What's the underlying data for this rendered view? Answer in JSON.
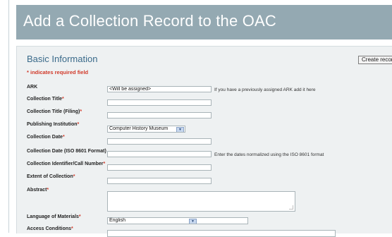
{
  "header": {
    "title": "Add a Collection Record to the OAC"
  },
  "form": {
    "section_title": "Basic Information",
    "required_note": "* indicates required field",
    "create_button_label": "Create record",
    "rows": {
      "ark": {
        "label": "ARK",
        "value": "<Will be assigned>",
        "hint": "If you have a previously assigned ARK add it here"
      },
      "collection_title": {
        "label": "Collection Title",
        "value": ""
      },
      "collection_title_filing": {
        "label": "Collection Title (Filing)",
        "value": ""
      },
      "publishing_institution": {
        "label": "Publishing Institution",
        "selected": "Computer History Museum"
      },
      "collection_date": {
        "label": "Collection Date",
        "value": ""
      },
      "collection_date_iso": {
        "label": "Collection Date (ISO 8601 Format)",
        "value": "",
        "hint": "Enter the dates normalized using the ISO 8601 format"
      },
      "collection_identifier": {
        "label": "Collection Identifier/Call Number",
        "value": ""
      },
      "extent": {
        "label": "Extent of Collection",
        "value": ""
      },
      "abstract": {
        "label": "Abstract",
        "value": ""
      },
      "language": {
        "label": "Language of Materials",
        "selected": "English"
      },
      "access_conditions": {
        "label": "Access Conditions",
        "value": ""
      }
    },
    "required_marker": "*"
  },
  "colors": {
    "header_bg": "#94a9b2",
    "panel_bg": "#eef1f2",
    "section_title": "#3a6a8a",
    "required": "#d13a2a"
  }
}
